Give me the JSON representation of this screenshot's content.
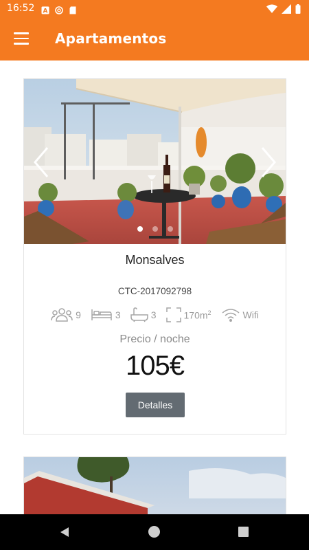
{
  "status_bar": {
    "time": "16:52",
    "left_icons": [
      "a-square-icon",
      "at-circle-icon",
      "sd-card-icon"
    ],
    "right_icons": [
      "wifi-icon",
      "signal-icon",
      "battery-icon"
    ]
  },
  "app_bar": {
    "title": "Apartamentos",
    "menu_icon": "menu-icon",
    "color": "#f47a20"
  },
  "listings": [
    {
      "name": "Monsalves",
      "code": "CTC-2017092798",
      "features": {
        "guests": "9",
        "bedrooms": "3",
        "bathrooms": "3",
        "area": "170m",
        "area_sup": "2",
        "wifi": "Wifi"
      },
      "price_label": "Precio / noche",
      "price": "105€",
      "details_label": "Detalles",
      "carousel": {
        "slides": 3,
        "active_slide": 1
      }
    }
  ],
  "nav_bar": {
    "icons": [
      "back-icon",
      "home-icon",
      "recents-icon"
    ]
  }
}
